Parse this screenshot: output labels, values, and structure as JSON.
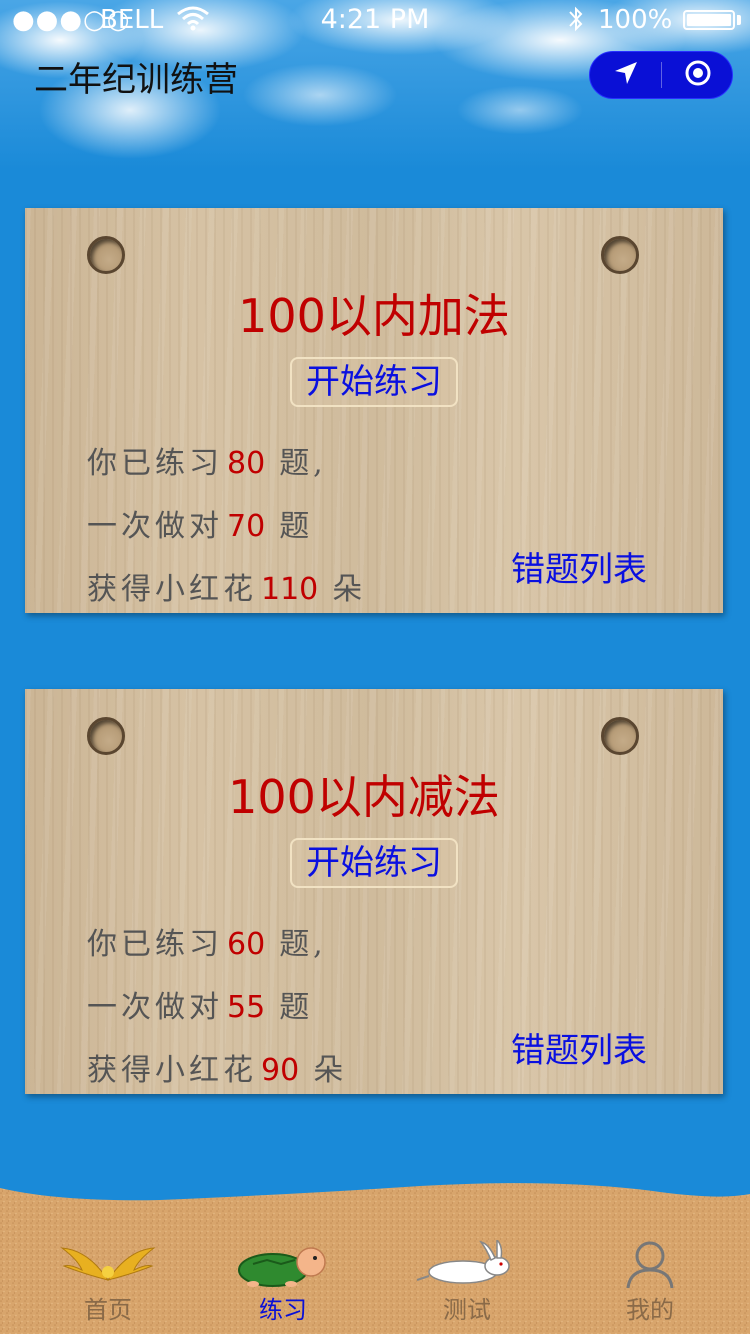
{
  "status_bar": {
    "signal": "●●●○○",
    "carrier": "BELL",
    "time": "4:21 PM",
    "battery": "100%"
  },
  "header": {
    "title": "二年纪训练营"
  },
  "capsule": {
    "left_icon": "location-arrow-icon",
    "right_icon": "target-icon"
  },
  "cards": [
    {
      "title": "100以内加法",
      "start_label": "开始练习",
      "practiced_prefix": "你已练习",
      "practiced_count": "80",
      "practiced_suffix": "题,",
      "correct_prefix": "一次做对",
      "correct_count": "70",
      "correct_suffix": "题",
      "flowers_prefix": "获得小红花",
      "flowers_count": "110",
      "flowers_suffix": "朵",
      "wrong_list_label": "错题列表"
    },
    {
      "title": "100以内减法",
      "start_label": "开始练习",
      "practiced_prefix": "你已练习",
      "practiced_count": "60",
      "practiced_suffix": "题,",
      "correct_prefix": "一次做对",
      "correct_count": "55",
      "correct_suffix": "题",
      "flowers_prefix": "获得小红花",
      "flowers_count": "90",
      "flowers_suffix": "朵",
      "wrong_list_label": "错题列表"
    }
  ],
  "tabbar": {
    "active_index": 1,
    "items": [
      {
        "label": "首页",
        "icon": "golden-wings-icon"
      },
      {
        "label": "练习",
        "icon": "turtle-icon"
      },
      {
        "label": "测试",
        "icon": "rabbit-icon"
      },
      {
        "label": "我的",
        "icon": "user-icon"
      }
    ]
  },
  "colors": {
    "background": "#1a8ad8",
    "accent_blue": "#0a10e0",
    "number_red": "#c00000",
    "wood": "#d6c2a4",
    "sand": "#d9a870"
  }
}
